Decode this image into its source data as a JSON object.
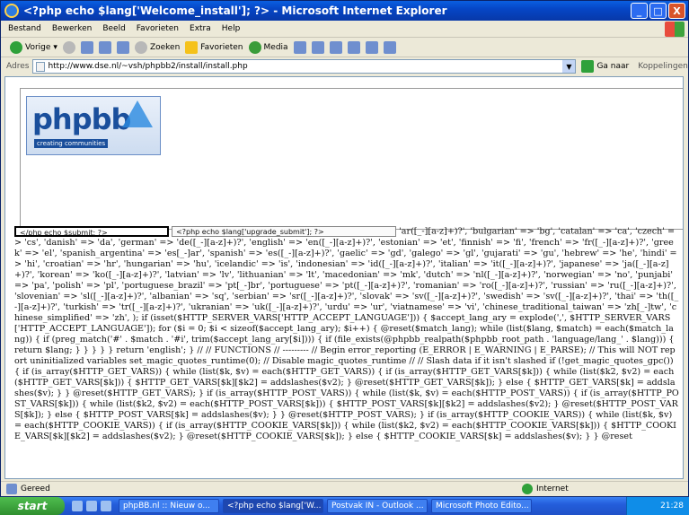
{
  "window": {
    "title": "<?php echo $lang['Welcome_install']; ?> - Microsoft Internet Explorer",
    "controls": {
      "minimize": "_",
      "maximize": "□",
      "close": "X"
    }
  },
  "menubar": {
    "items": [
      "Bestand",
      "Bewerken",
      "Beeld",
      "Favorieten",
      "Extra",
      "Help"
    ]
  },
  "toolbar": {
    "back_label": "Vorige",
    "search_label": "Zoeken",
    "favorites_label": "Favorieten",
    "media_label": "Media"
  },
  "address": {
    "label": "Adres",
    "url": "http://www.dse.nl/~vsh/phpbb2/install/install.php",
    "go_label": "Ga naar",
    "links_label": "Koppelingen"
  },
  "page": {
    "logo_text": "phpbb",
    "logo_tagline": "creating communities",
    "submit_box": "</php echo $submit; ?>",
    "upgrade_box": "<?php echo $lang['upgrade_submit']; ?>",
    "raw_php": "'ar([_-][a-z]+)?', 'bulgarian' => 'bg', 'catalan' => 'ca', 'czech' => 'cs', 'danish' => 'da', 'german' => 'de([_-][a-z]+)?', 'english' => 'en([_-][a-z]+)?', 'estonian' => 'et', 'finnish' => 'fi', 'french' => 'fr([_-][a-z]+)?', 'greek' => 'el', 'spanish_argentina' => 'es[_-]ar', 'spanish' => 'es([_-][a-z]+)?', 'gaelic' => 'gd', 'galego' => 'gl', 'gujarati' => 'gu', 'hebrew' => 'he', 'hindi' => 'hi', 'croatian' => 'hr', 'hungarian' => 'hu', 'icelandic' => 'is', 'indonesian' => 'id([_-][a-z]+)?', 'italian' => 'it([_-][a-z]+)?', 'japanese' => 'ja([_-][a-z]+)?', 'korean' => 'ko([_-][a-z]+)?', 'latvian' => 'lv', 'lithuanian' => 'lt', 'macedonian' => 'mk', 'dutch' => 'nl([_-][a-z]+)?', 'norwegian' => 'no', 'punjabi' => 'pa', 'polish' => 'pl', 'portuguese_brazil' => 'pt[_-]br', 'portuguese' => 'pt([_-][a-z]+)?', 'romanian' => 'ro([_-][a-z]+)?', 'russian' => 'ru([_-][a-z]+)?', 'slovenian' => 'sl([_-][a-z]+)?', 'albanian' => 'sq', 'serbian' => 'sr([_-][a-z]+)?', 'slovak' => 'sv([_-][a-z]+)?', 'swedish' => 'sv([_-][a-z]+)?', 'thai' => 'th([_-][a-z]+)?', 'turkish' => 'tr([_-][a-z]+)?', 'ukranian' => 'uk([_-][a-z]+)?', 'urdu' => 'ur', 'viatnamese' => 'vi', 'chinese_traditional_taiwan' => 'zh[_-]tw', 'chinese_simplified' => 'zh', ); if (isset($HTTP_SERVER_VARS['HTTP_ACCEPT_LANGUAGE'])) { $accept_lang_ary = explode(',', $HTTP_SERVER_VARS['HTTP_ACCEPT_LANGUAGE']); for ($i = 0; $i < sizeof($accept_lang_ary); $i++) { @reset($match_lang); while (list($lang, $match) = each($match_lang)) { if (preg_match('#' . $match . '#i', trim($accept_lang_ary[$i]))) { if (file_exists(@phpbb_realpath($phpbb_root_path . 'language/lang_' . $lang))) { return $lang; } } } } } return 'english'; } // // FUNCTIONS // --------- // Begin error_reporting (E_ERROR | E_WARNING | E_PARSE); // This will NOT report uninitialized variables set_magic_quotes_runtime(0); // Disable magic_quotes_runtime // // Slash data if it isn't slashed if (!get_magic_quotes_gpc()) { if (is_array($HTTP_GET_VARS)) { while (list($k, $v) = each($HTTP_GET_VARS)) { if (is_array($HTTP_GET_VARS[$k])) { while (list($k2, $v2) = each($HTTP_GET_VARS[$k])) { $HTTP_GET_VARS[$k][$k2] = addslashes($v2); } @reset($HTTP_GET_VARS[$k]); } else { $HTTP_GET_VARS[$k] = addslashes($v); } } @reset($HTTP_GET_VARS); } if (is_array($HTTP_POST_VARS)) { while (list($k, $v) = each($HTTP_POST_VARS)) { if (is_array($HTTP_POST_VARS[$k])) { while (list($k2, $v2) = each($HTTP_POST_VARS[$k])) { $HTTP_POST_VARS[$k][$k2] = addslashes($v2); } @reset($HTTP_POST_VARS[$k]); } else { $HTTP_POST_VARS[$k] = addslashes($v); } } @reset($HTTP_POST_VARS); } if (is_array($HTTP_COOKIE_VARS)) { while (list($k, $v) = each($HTTP_COOKIE_VARS)) { if (is_array($HTTP_COOKIE_VARS[$k])) { while (list($k2, $v2) = each($HTTP_COOKIE_VARS[$k])) { $HTTP_COOKIE_VARS[$k][$k2] = addslashes($v2); } @reset($HTTP_COOKIE_VARS[$k]); } else { $HTTP_COOKIE_VARS[$k] = addslashes($v); } } @reset"
  },
  "status": {
    "left": "Gereed",
    "zone": "Internet"
  },
  "taskbar": {
    "start_label": "start",
    "tasks": [
      "phpBB.nl :: Nieuw o...",
      "<?php echo $lang['W...",
      "Postvak IN - Outlook ...",
      "Microsoft Photo Edito..."
    ],
    "active_task": 1,
    "clock": "21:28"
  }
}
